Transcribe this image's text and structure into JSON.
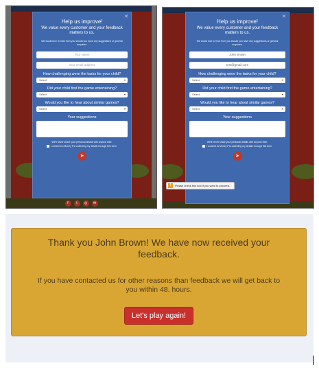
{
  "colors": {
    "modal_bg": "#3f68ad",
    "page_bg": "#7a1f16",
    "card_bg": "#d9a634",
    "play_button": "#c9302c"
  },
  "form": {
    "title": "Help us improve!",
    "subtitle": "We value every customer and your feedback matters to us.",
    "intro": "We would love to hear from you should you have any suggestions or general enquiries.",
    "name_placeholder": "Your Name",
    "email_placeholder": "Your email address",
    "filled_name": "John Brown",
    "filled_email": "test@gmail.com",
    "q1": "How challenging were the tasks for your child?",
    "q2": "Did your child find the game entertaining?",
    "q3": "Would you like to hear about similar games?",
    "select_default": "Select",
    "suggestions_label": "Your suggestions",
    "privacy": "We'll never share your personal details with anyone else.",
    "consent": "I consent to Money Pot collecting my details through this form.",
    "close_icon": "close-icon",
    "send_icon": "paper-plane-icon"
  },
  "tooltip": {
    "icon": "!",
    "text": "Please check this box if you want to proceed."
  },
  "social_icons": [
    "facebook-icon",
    "twitter-icon",
    "instagram-icon",
    "email-icon"
  ],
  "thanks": {
    "heading": "Thank you John Brown! We have now received your feedback.",
    "body": "If you have contacted us for other reasons than feedback we will get back to you within 48. hours.",
    "button": "Let's play again!"
  }
}
